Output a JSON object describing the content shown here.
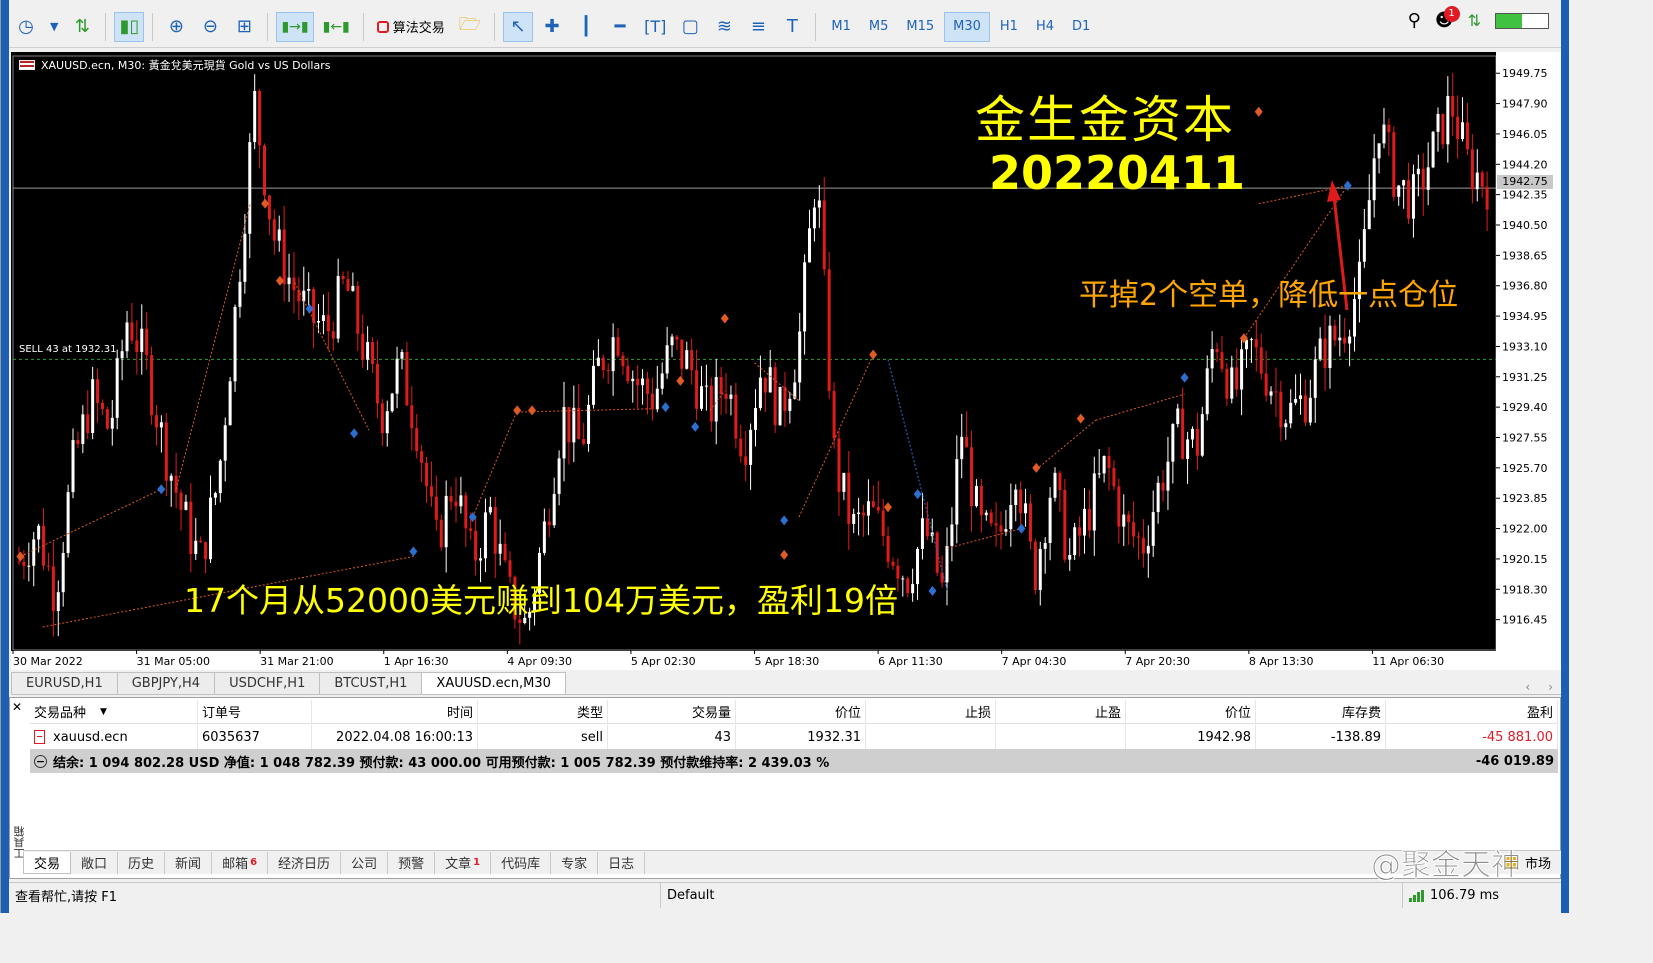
{
  "toolbar": {
    "algo_trading_label": "算法交易",
    "timeframes": [
      "M1",
      "M5",
      "M15",
      "M30",
      "H1",
      "H4",
      "D1"
    ],
    "active_timeframe": "M30",
    "notification_count": "1",
    "signal_level": 0.5,
    "icons": [
      "clock-icon",
      "chevron-down-icon",
      "new-order-icon",
      "candlestick-icon",
      "zoom-in-icon",
      "zoom-out-icon",
      "tile-windows-icon",
      "scroll-right-icon",
      "autoscroll-icon",
      "algo-trading-icon",
      "folder-icon",
      "cursor-icon",
      "crosshair-icon",
      "vertical-line-icon",
      "horizontal-line-icon",
      "text-tool-icon",
      "rectangle-icon",
      "fibonacci-icon",
      "channel-icon",
      "text-icon",
      "search-icon",
      "notification-icon",
      "signal-level-icon",
      "battery-icon"
    ]
  },
  "chart": {
    "title": "XAUUSD.ecn, M30:  黃金兌美元現貨  Gold vs US Dollars",
    "overlay_brand": "金生金资本",
    "overlay_date": "20220411",
    "overlay_close": "平掉2个空单，降低一点仓位",
    "overlay_profit": "17个月从52000美元赚到104万美元，盈利19倍",
    "sell_line_label": "SELL 43 at 1932.31",
    "current_price": "1942.75",
    "colors": {
      "background": "#000000",
      "bull": "#ffffff",
      "bear": "#e01b1b",
      "sell_line": "#2aa02a",
      "overlay_yellow": "#ffff00",
      "overlay_orange": "#ffa500",
      "arrow": "#e01b1b"
    }
  },
  "chart_data": {
    "type": "candlestick",
    "title": "XAUUSD.ecn, M30",
    "y_ticks": [
      "1949.75",
      "1947.90",
      "1946.05",
      "1944.20",
      "1942.35",
      "1940.50",
      "1938.65",
      "1936.80",
      "1934.95",
      "1933.10",
      "1931.25",
      "1929.40",
      "1927.55",
      "1925.70",
      "1923.85",
      "1922.00",
      "1920.15",
      "1918.30",
      "1916.45"
    ],
    "x_ticks": [
      "30 Mar 2022",
      "31 Mar 05:00",
      "31 Mar 21:00",
      "1 Apr 16:30",
      "4 Apr 09:30",
      "5 Apr 02:30",
      "5 Apr 18:30",
      "6 Apr 11:30",
      "7 Apr 04:30",
      "7 Apr 20:30",
      "8 Apr 13:30",
      "11 Apr 06:30"
    ],
    "ylim": [
      1914.6,
      1950.8
    ],
    "horizontal_lines": [
      1942.75,
      1932.31
    ],
    "close_path": [
      1920,
      1922,
      1918,
      1926,
      1930,
      1928,
      1935,
      1932,
      1927,
      1923,
      1920,
      1925,
      1936,
      1948,
      1940,
      1937,
      1935,
      1934,
      1937,
      1933,
      1929,
      1932,
      1928,
      1921,
      1925,
      1920,
      1923,
      1918,
      1916,
      1922,
      1929,
      1927,
      1932,
      1934,
      1931,
      1930,
      1933,
      1932,
      1929,
      1931,
      1927,
      1932,
      1929,
      1933,
      1944,
      1926,
      1922,
      1923,
      1921,
      1919,
      1922,
      1918,
      1928,
      1922,
      1921,
      1926,
      1919,
      1925,
      1920,
      1923,
      1926,
      1922,
      1921,
      1925,
      1928,
      1927,
      1934,
      1930,
      1933,
      1931,
      1929,
      1930,
      1933,
      1934,
      1937,
      1947,
      1943,
      1942,
      1945,
      1948,
      1944,
      1943
    ]
  },
  "chart_tabs": [
    "EURUSD,H1",
    "GBPJPY,H4",
    "USDCHF,H1",
    "BTCUST,H1",
    "XAUUSD.ecn,M30"
  ],
  "active_chart_tab": "XAUUSD.ecn,M30",
  "terminal": {
    "columns": [
      "交易品种",
      "订单号",
      "时间",
      "类型",
      "交易量",
      "价位",
      "止损",
      "止盈",
      "价位",
      "库存费",
      "盈利"
    ],
    "rows": [
      {
        "symbol": "xauusd.ecn",
        "order": "6035637",
        "time": "2022.04.08 16:00:13",
        "type": "sell",
        "volume": "43",
        "open_price": "1932.31",
        "sl": "",
        "tp": "",
        "price": "1942.98",
        "swap": "-138.89",
        "profit": "-45 881.00"
      }
    ],
    "summary": "结余: 1 094 802.28 USD  净值: 1 048 782.39  预付款: 43 000.00  可用预付款: 1 005 782.39  预付款维持率: 2 439.03 %",
    "summary_profit": "-46 019.89",
    "side_label": "工具箱",
    "tabs": [
      {
        "label": "交易",
        "badge": ""
      },
      {
        "label": "敞口",
        "badge": ""
      },
      {
        "label": "历史",
        "badge": ""
      },
      {
        "label": "新闻",
        "badge": ""
      },
      {
        "label": "邮箱",
        "badge": "6"
      },
      {
        "label": "经济日历",
        "badge": ""
      },
      {
        "label": "公司",
        "badge": ""
      },
      {
        "label": "预警",
        "badge": ""
      },
      {
        "label": "文章",
        "badge": "1"
      },
      {
        "label": "代码库",
        "badge": ""
      },
      {
        "label": "专家",
        "badge": ""
      },
      {
        "label": "日志",
        "badge": ""
      }
    ],
    "market_label": "市场",
    "watermark": "@聚金天神"
  },
  "statusbar": {
    "help": "查看帮忙,请按 F1",
    "profile": "Default",
    "ping": "106.79 ms"
  }
}
